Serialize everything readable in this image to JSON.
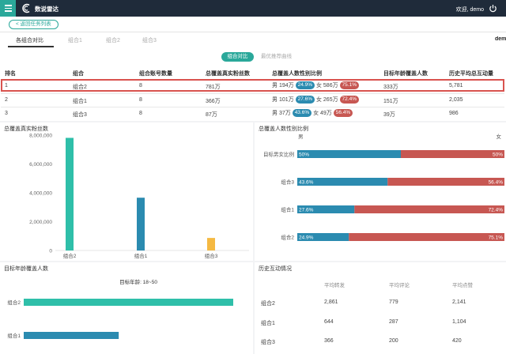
{
  "header": {
    "app_title": "数说雷达",
    "welcome": "欢迎, demo",
    "colors": {
      "bar": "#1f2b3a",
      "accent": "#2aa89a"
    },
    "icons": {
      "menu": "menu-icon",
      "logo": "logo-icon",
      "power": "power-icon"
    }
  },
  "back_button": "< 返回任务列表",
  "tabs": [
    "各组合对比",
    "组合1",
    "组合2",
    "组合3"
  ],
  "truncated_label": "dem",
  "subtabs": {
    "active": "组合对比",
    "inactive": "最优推荐曲线"
  },
  "table": {
    "headers": [
      "排名",
      "组合",
      "组合账号数量",
      "总覆盖真实粉丝数",
      "总覆盖人数性别比例",
      "目标年龄覆盖人数",
      "历史平均总互动量"
    ],
    "rows": [
      {
        "rank": "1",
        "combo": "组合2",
        "accounts": "8",
        "fans": "781万",
        "male_label": "男 194万",
        "male_pct": "24.9%",
        "female_label": "女 586万",
        "female_pct": "75.1%",
        "target": "333万",
        "interaction": "5,781"
      },
      {
        "rank": "2",
        "combo": "组合1",
        "accounts": "8",
        "fans": "366万",
        "male_label": "男 101万",
        "male_pct": "27.6%",
        "female_label": "女 265万",
        "female_pct": "72.4%",
        "target": "151万",
        "interaction": "2,035"
      },
      {
        "rank": "3",
        "combo": "组合3",
        "accounts": "8",
        "fans": "87万",
        "male_label": "男 37万",
        "male_pct": "43.6%",
        "female_label": "女 49万",
        "female_pct": "56.4%",
        "target": "39万",
        "interaction": "986"
      }
    ]
  },
  "panels": {
    "fans_title": "总覆盖真实粉丝数",
    "gender_title": "总覆盖人数性别比例",
    "age_title": "目标年龄覆盖人数",
    "history_title": "历史互动情况"
  },
  "chart_data": [
    {
      "type": "bar",
      "title": "总覆盖真实粉丝数",
      "categories": [
        "组合2",
        "组合1",
        "组合3"
      ],
      "values": [
        7810000,
        3660000,
        870000
      ],
      "colors": [
        "#2fbfa9",
        "#2b8bb0",
        "#f5b942"
      ],
      "ylim": [
        0,
        8000000
      ],
      "yticks": [
        "0",
        "2,000,000",
        "4,000,000",
        "6,000,000",
        "8,000,000"
      ]
    },
    {
      "type": "bar",
      "title": "总覆盖人数性别比例",
      "legend_left": "男",
      "legend_right": "女",
      "categories": [
        "目标男女比例",
        "组合3",
        "组合1",
        "组合2"
      ],
      "series": [
        {
          "values": [
            50,
            43.6,
            27.6,
            24.9
          ],
          "labels": [
            "50%",
            "43.6%",
            "27.6%",
            "24.9%"
          ],
          "color": "#2b8bb0"
        },
        {
          "values": [
            50,
            56.4,
            72.4,
            75.1
          ],
          "labels": [
            "50%",
            "56.4%",
            "72.4%",
            "75.1%"
          ],
          "color": "#c75752"
        }
      ]
    },
    {
      "type": "bar",
      "title": "目标年龄覆盖人数",
      "subtitle": "目标年龄: 18~50",
      "categories": [
        "组合2",
        "组合1"
      ],
      "values": [
        3330000,
        1510000
      ],
      "colors": [
        "#2fbfa9",
        "#2b8bb0"
      ]
    }
  ],
  "history": {
    "columns": [
      "平均转发",
      "平均评论",
      "平均点赞"
    ],
    "rows": [
      {
        "name": "组合2",
        "values": [
          "2,861",
          "779",
          "2,141"
        ]
      },
      {
        "name": "组合1",
        "values": [
          "644",
          "287",
          "1,104"
        ]
      },
      {
        "name": "组合3",
        "values": [
          "366",
          "200",
          "420"
        ]
      }
    ]
  }
}
